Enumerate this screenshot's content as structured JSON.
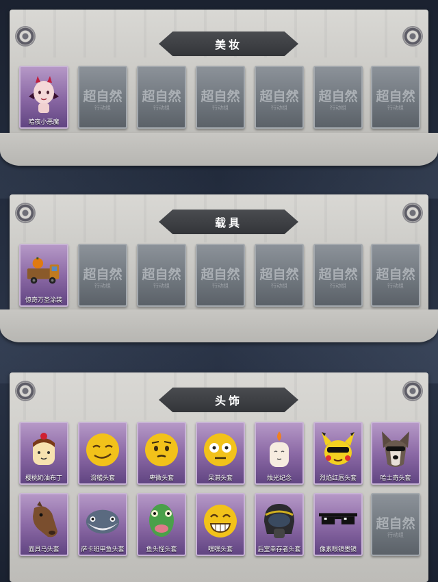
{
  "sections": [
    {
      "title": "美妆",
      "items": [
        {
          "label": "暗夜小恶魔",
          "owned": true,
          "icon": "devil-doll-icon"
        },
        {
          "owned": false
        },
        {
          "owned": false
        },
        {
          "owned": false
        },
        {
          "owned": false
        },
        {
          "owned": false
        },
        {
          "owned": false
        }
      ]
    },
    {
      "title": "载具",
      "items": [
        {
          "label": "惊奇万圣涂装",
          "owned": true,
          "icon": "halloween-truck-icon"
        },
        {
          "owned": false
        },
        {
          "owned": false
        },
        {
          "owned": false
        },
        {
          "owned": false
        },
        {
          "owned": false
        },
        {
          "owned": false
        }
      ]
    },
    {
      "title": "头饰",
      "items": [
        {
          "label": "樱桃奶油布丁",
          "owned": true,
          "icon": "pudding-head-icon"
        },
        {
          "label": "滑稽头套",
          "owned": true,
          "icon": "smirk-emoji-head-icon"
        },
        {
          "label": "卑微头套",
          "owned": true,
          "icon": "sad-emoji-head-icon"
        },
        {
          "label": "呆滞头套",
          "owned": true,
          "icon": "dazed-emoji-head-icon"
        },
        {
          "label": "烛光纪念",
          "owned": true,
          "icon": "candle-head-icon"
        },
        {
          "label": "烈焰红唇头套",
          "owned": true,
          "icon": "yellow-mouse-head-icon"
        },
        {
          "label": "哈士奇头套",
          "owned": true,
          "icon": "husky-head-icon"
        },
        {
          "label": "面具马头套",
          "owned": true,
          "icon": "horse-head-icon"
        },
        {
          "label": "萨卡班甲鱼头套",
          "owned": true,
          "icon": "fish-head-icon"
        },
        {
          "label": "鱼头怪头套",
          "owned": true,
          "icon": "fish-monster-head-icon"
        },
        {
          "label": "嘿嘿头套",
          "owned": true,
          "icon": "grin-emoji-head-icon"
        },
        {
          "label": "后室幸存者头套",
          "owned": true,
          "icon": "gas-mask-helmet-icon"
        },
        {
          "label": "像素眼镜墨镜",
          "owned": true,
          "icon": "pixel-sunglasses-icon"
        },
        {
          "owned": false
        }
      ]
    }
  ],
  "locked_watermark": "超自然",
  "locked_watermark_sub": "行动组",
  "colors": {
    "owned_card": "#8c6aa6",
    "locked_card": "#6e757c",
    "banner": "#3a3c40"
  }
}
